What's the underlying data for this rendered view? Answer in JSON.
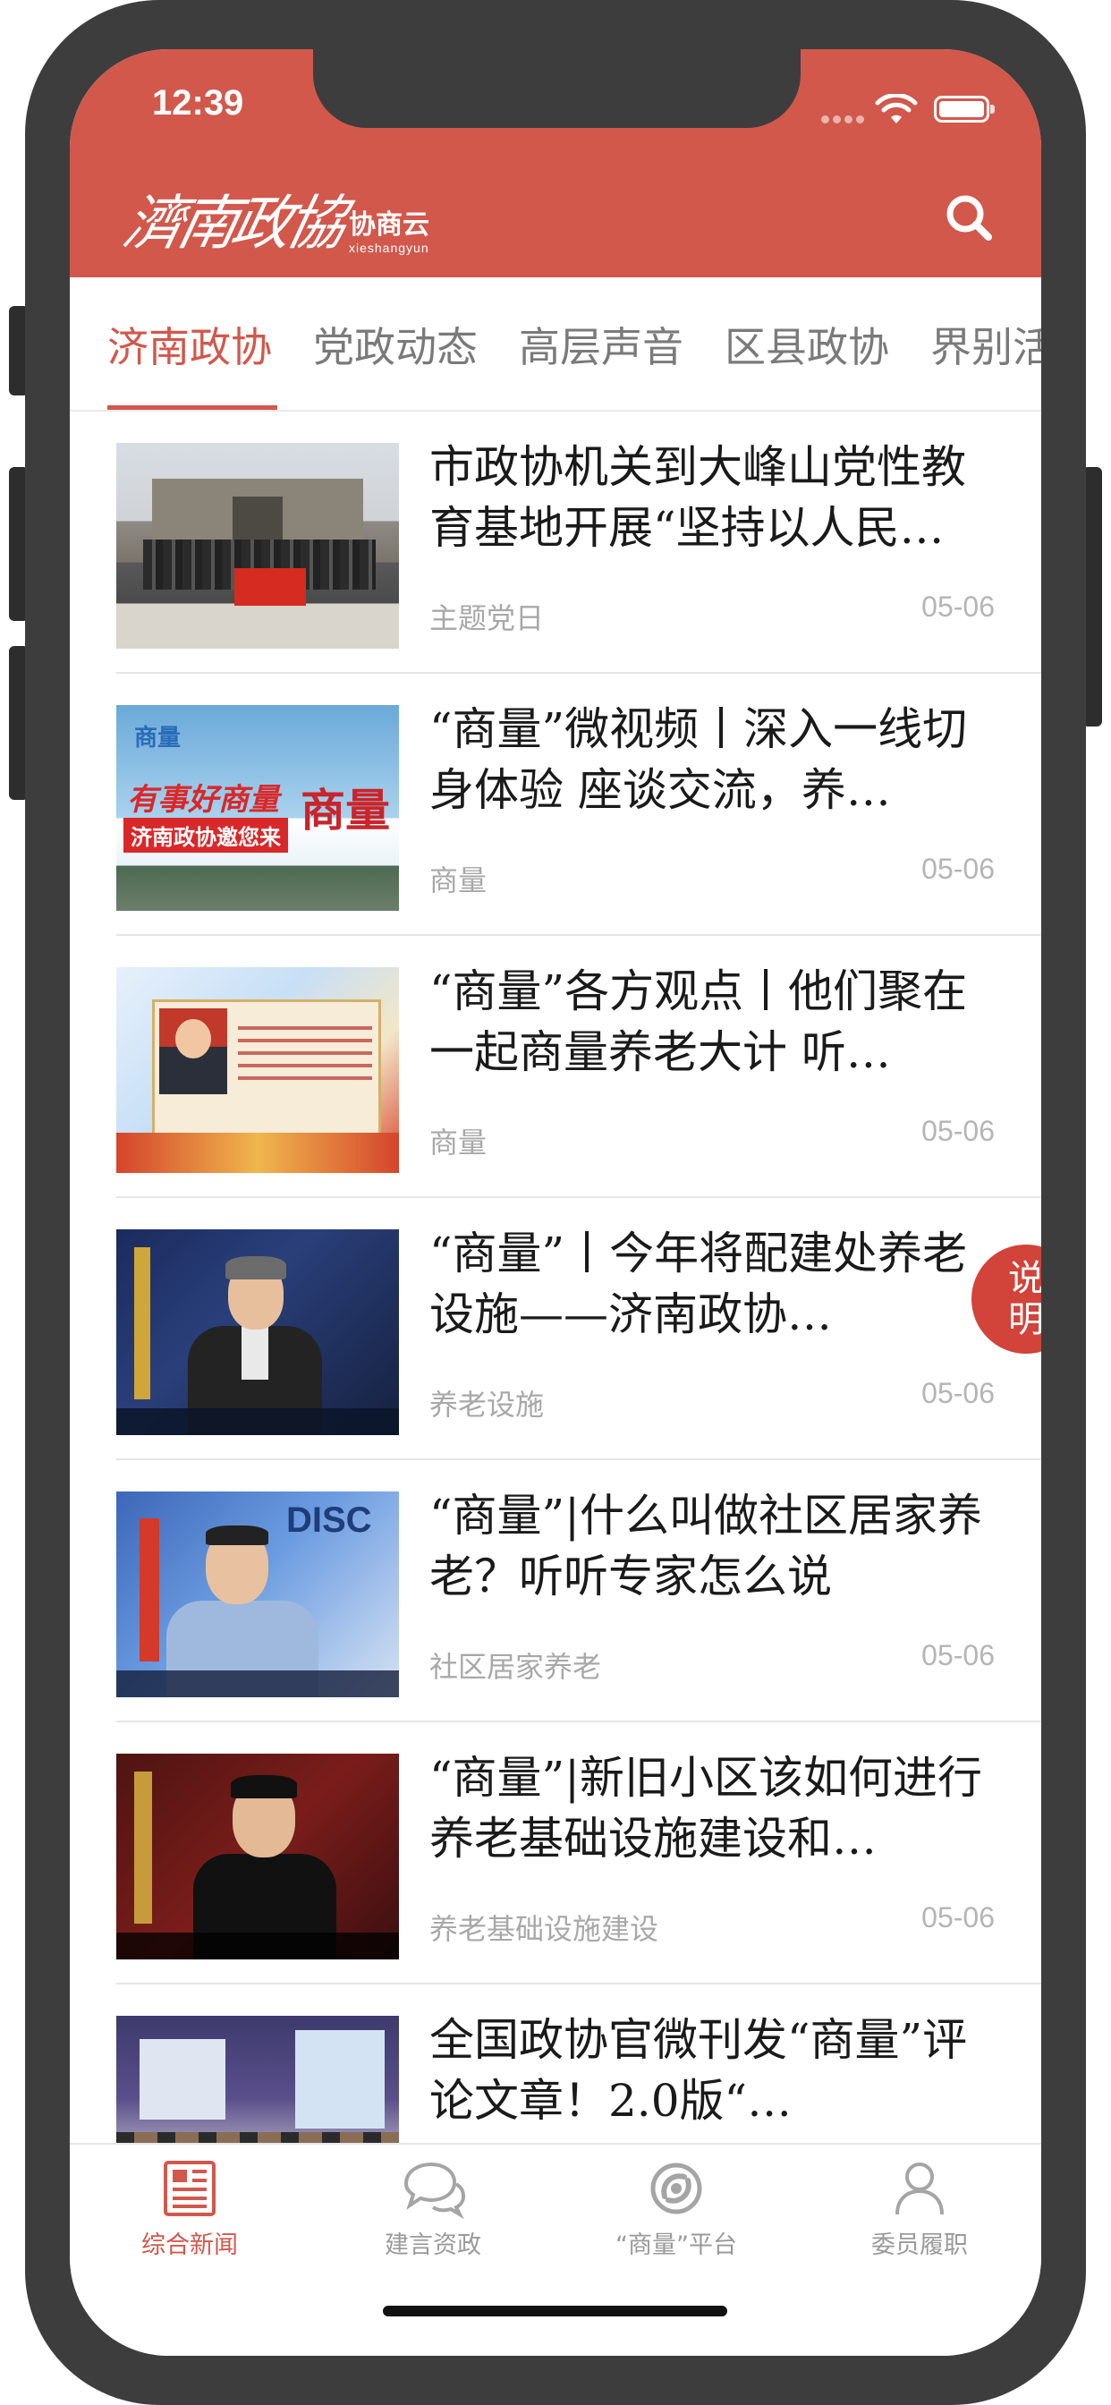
{
  "status_bar": {
    "time": "12:39"
  },
  "header": {
    "logo_script": "濟南政協",
    "logo_cn": "协商云",
    "logo_en": "xieshangyun",
    "accent_color": "#d2584c",
    "search_icon": "search-icon"
  },
  "tabs": [
    {
      "label": "济南政协",
      "active": true
    },
    {
      "label": "党政动态",
      "active": false
    },
    {
      "label": "高层声音",
      "active": false
    },
    {
      "label": "区县政协",
      "active": false
    },
    {
      "label": "界别活",
      "active": false
    }
  ],
  "articles": [
    {
      "title": "市政协机关到大峰山党性教育基地开展“坚持以人民…",
      "tag": "主题党日",
      "date": "05-06"
    },
    {
      "title": "“商量”微视频丨深入一线切身体验 座谈交流，养…",
      "tag": "商量",
      "date": "05-06",
      "thumb": {
        "brand": "商量",
        "line1": "有事好商量",
        "line2": "济南政协邀您来",
        "big": "商量"
      }
    },
    {
      "title": "“商量”各方观点丨他们聚在一起商量养老大计 听…",
      "tag": "商量",
      "date": "05-06"
    },
    {
      "title": "“商量”丨今年将配建处养老设施——济南政协…",
      "tag": "养老设施",
      "date": "05-06"
    },
    {
      "title": "“商量”|什么叫做社区居家养老？听听专家怎么说",
      "tag": "社区居家养老",
      "date": "05-06",
      "thumb": {
        "disc": "DISC"
      }
    },
    {
      "title": "“商量”|新旧小区该如何进行养老基础设施建设和…",
      "tag": "养老基础设施建设",
      "date": "05-06"
    },
    {
      "title": "全国政协官微刊发“商量”评论文章！2.0版“…",
      "tag": "",
      "date": ""
    }
  ],
  "badge": {
    "label": "说明"
  },
  "bottom_nav": [
    {
      "label": "综合新闻",
      "icon": "newspaper-icon",
      "active": true
    },
    {
      "label": "建言资政",
      "icon": "chat-bubbles-icon",
      "active": false
    },
    {
      "label": "“商量”平台",
      "icon": "swirl-logo-icon",
      "active": false
    },
    {
      "label": "委员履职",
      "icon": "person-icon",
      "active": false
    }
  ]
}
